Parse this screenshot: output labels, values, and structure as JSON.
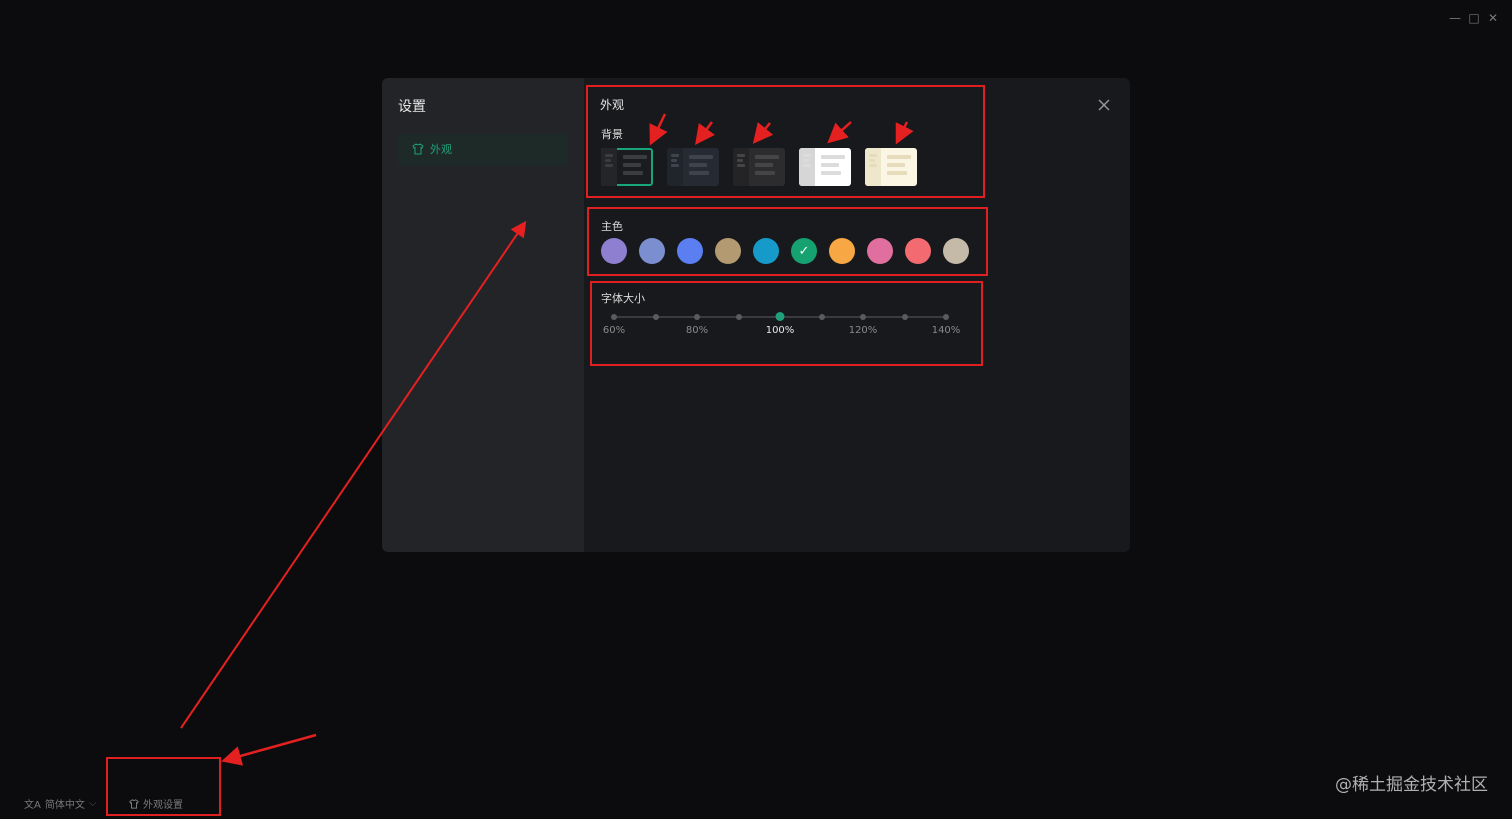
{
  "window_controls": [
    "minimize-icon",
    "maximize-icon",
    "close-icon"
  ],
  "dialog": {
    "title": "设置",
    "sidebar_items": [
      {
        "label": "外观",
        "icon": "shirt-icon"
      }
    ],
    "close_icon": "close-icon"
  },
  "appearance": {
    "title": "外观",
    "background_label": "背景",
    "backgrounds": [
      {
        "name": "dark-green",
        "base": "#1a1c1f",
        "pane": "#232528",
        "line": "#3a3c40",
        "selected": true
      },
      {
        "name": "dark-navy",
        "base": "#262a33",
        "pane": "#20242b",
        "line": "#3e434d",
        "selected": false
      },
      {
        "name": "dark-gray",
        "base": "#2c2c2e",
        "pane": "#242426",
        "line": "#454547",
        "selected": false
      },
      {
        "name": "light-white",
        "base": "#ffffff",
        "pane": "#d6d6d6",
        "line": "#dcdcdc",
        "selected": false
      },
      {
        "name": "light-cream",
        "base": "#fbf6e3",
        "pane": "#eee7cc",
        "line": "#e6dcbc",
        "selected": false
      }
    ],
    "primary_color_label": "主色",
    "colors": [
      "#8e7fd1",
      "#7b8fd0",
      "#5b7ef0",
      "#b39a70",
      "#159ac9",
      "#16a171",
      "#f7a743",
      "#e06fa0",
      "#f36a70",
      "#c5b9a8"
    ],
    "selected_color_index": 5,
    "font_size_label": "字体大小",
    "font_sizes": [
      "60%",
      "80%",
      "100%",
      "120%",
      "140%"
    ],
    "font_size_selected": "100%",
    "font_size_selected_index": 4,
    "slider_steps": 9
  },
  "statusbar": {
    "language_label": "简体中文",
    "appearance_label": "外观设置"
  },
  "watermark": "@稀土掘金技术社区"
}
